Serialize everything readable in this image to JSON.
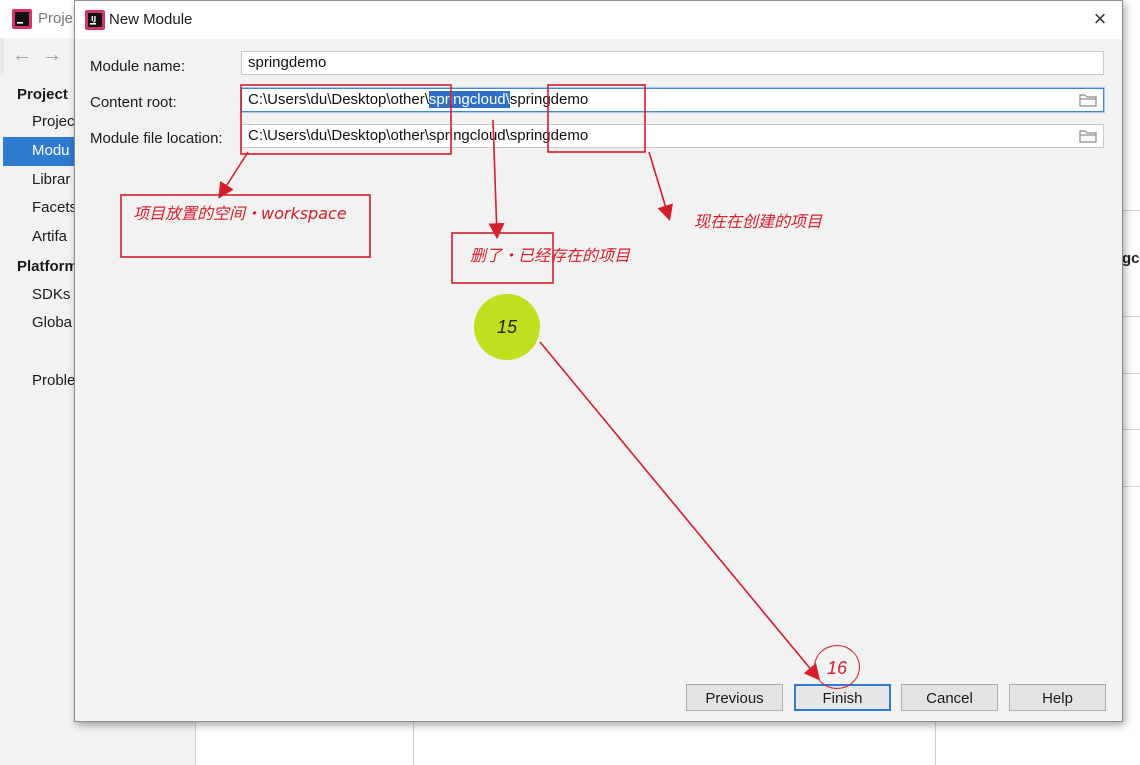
{
  "background_window": {
    "title": "Proje",
    "sidebar": {
      "project_settings_header": "Project",
      "items": [
        "Projec",
        "Modu",
        "Librar",
        "Facets",
        "Artifa"
      ],
      "selected_index": 1,
      "platform_header": "Platform",
      "platform_items": [
        "SDKs",
        "Globa"
      ],
      "problems_item": "Proble"
    },
    "right_edge_text": "gc"
  },
  "dialog": {
    "title": "New Module",
    "module_name": {
      "label": "Module name:",
      "value": "springdemo"
    },
    "content_root": {
      "label": "Content root:",
      "value_prefix": "C:\\Users\\du\\Desktop\\other\\",
      "value_selected": "springcloud\\",
      "value_suffix": "springdemo"
    },
    "module_file_location": {
      "label": "Module file location:",
      "value": "C:\\Users\\du\\Desktop\\other\\springcloud\\springdemo"
    },
    "buttons": {
      "previous": "Previous",
      "finish": "Finish",
      "cancel": "Cancel",
      "help": "Help"
    }
  },
  "annotations": {
    "workspace_note": "项目放置的空间・workspace",
    "delete_note": "删了・已经存在的项目",
    "current_project_note": "现在在创建的项目",
    "step_15": "15",
    "step_16": "16"
  },
  "colors": {
    "accent": "#2f7bd0",
    "annotation_red": "#d41e2a",
    "step_circle": "#c0df1f"
  }
}
